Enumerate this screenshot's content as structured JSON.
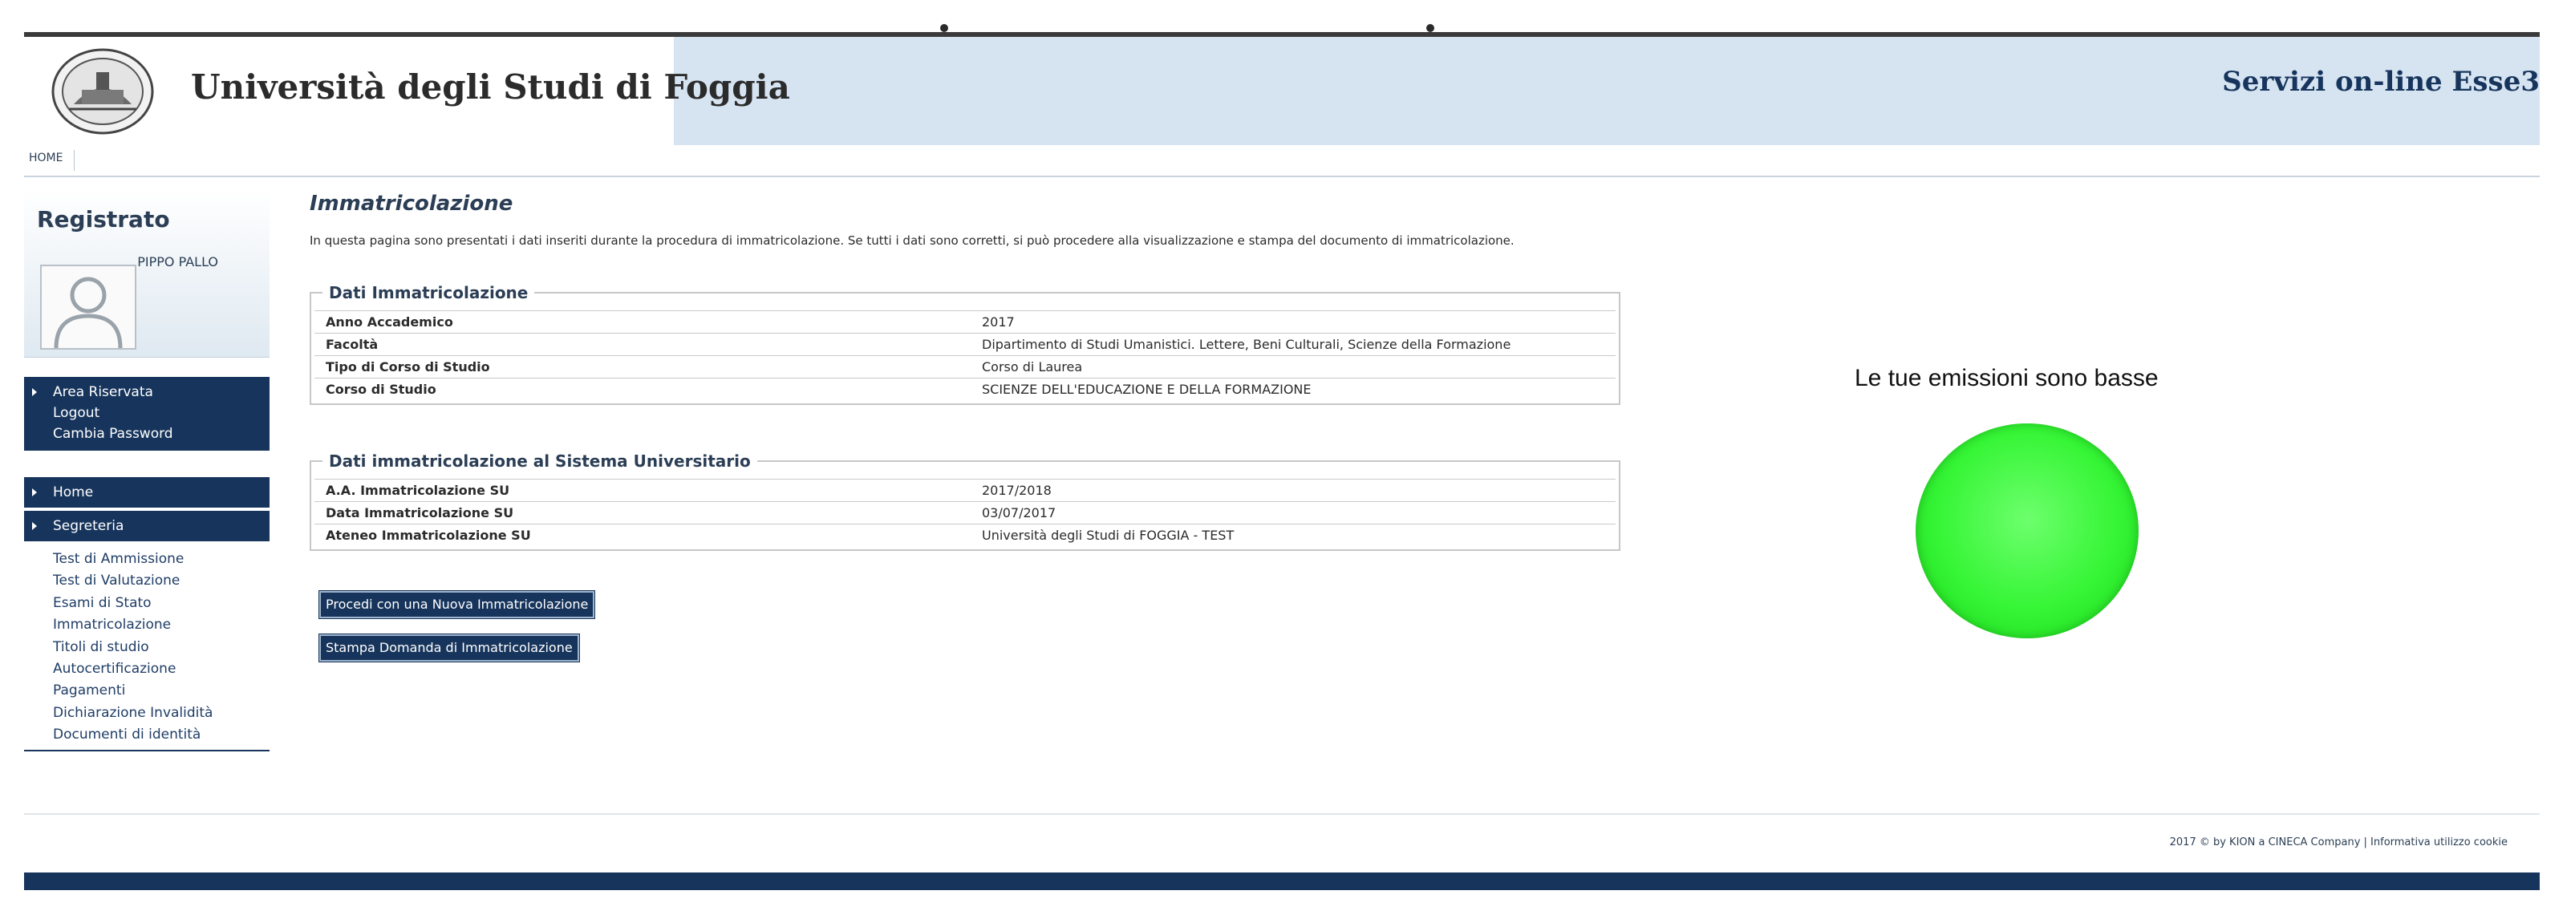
{
  "header": {
    "university": "Università degli Studi di Foggia",
    "services": "Servizi on-line Esse3"
  },
  "nav": {
    "home": "HOME"
  },
  "sidebar": {
    "title": "Registrato",
    "user": "PIPPO PALLO",
    "area": {
      "label": "Area Riservata",
      "items": [
        "Logout",
        "Cambia Password"
      ]
    },
    "home": "Home",
    "segreteria": "Segreteria",
    "sub_items": [
      "Test di Ammissione",
      "Test di Valutazione",
      "Esami di Stato",
      "Immatricolazione",
      "Titoli di studio",
      "Autocertificazione",
      "Pagamenti",
      "Dichiarazione Invalidità",
      "Documenti di identità"
    ]
  },
  "main": {
    "title": "Immatricolazione",
    "intro": "In questa pagina sono presentati i dati inseriti durante la procedura di immatricolazione. Se tutti i dati sono corretti, si può procedere alla visualizzazione e stampa del documento di immatricolazione.",
    "section1": {
      "legend": "Dati Immatricolazione",
      "rows": [
        {
          "label": "Anno Accademico",
          "value": "2017"
        },
        {
          "label": "Facoltà",
          "value": "Dipartimento di Studi Umanistici. Lettere, Beni Culturali, Scienze della Formazione"
        },
        {
          "label": "Tipo di Corso di Studio",
          "value": "Corso di Laurea"
        },
        {
          "label": "Corso di Studio",
          "value": "SCIENZE DELL'EDUCAZIONE E DELLA FORMAZIONE"
        }
      ]
    },
    "section2": {
      "legend": "Dati immatricolazione al Sistema Universitario",
      "rows": [
        {
          "label": "A.A. Immatricolazione SU",
          "value": "2017/2018"
        },
        {
          "label": "Data Immatricolazione SU",
          "value": "03/07/2017"
        },
        {
          "label": "Ateneo Immatricolazione SU",
          "value": "Università degli Studi di FOGGIA - TEST"
        }
      ]
    },
    "buttons": {
      "new_enrollment": "Procedi con una Nuova Immatricolazione",
      "print": "Stampa Domanda di Immatricolazione"
    }
  },
  "emissions": {
    "text": "Le tue emissioni sono basse",
    "color": "#36f536"
  },
  "footer": {
    "text": "2017 © by KION a CINECA Company | Informativa utilizzo cookie"
  },
  "colors": {
    "nav_dark": "#17355c",
    "header_bg": "#d6e4f2"
  }
}
